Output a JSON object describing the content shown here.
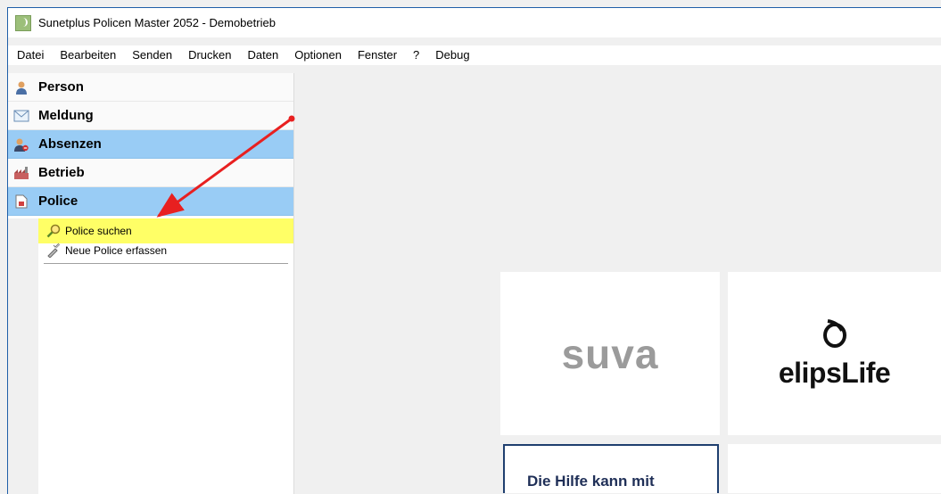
{
  "window": {
    "title": "Sunetplus Policen Master 2052 - Demobetrieb"
  },
  "menu": [
    "Datei",
    "Bearbeiten",
    "Senden",
    "Drucken",
    "Daten",
    "Optionen",
    "Fenster",
    "?",
    "Debug"
  ],
  "nav": {
    "sections": [
      {
        "label": "Person",
        "icon": "person-icon",
        "active": false
      },
      {
        "label": "Meldung",
        "icon": "envelope-icon",
        "active": false
      },
      {
        "label": "Absenzen",
        "icon": "absence-person-icon",
        "active": true
      },
      {
        "label": "Betrieb",
        "icon": "factory-icon",
        "active": false
      },
      {
        "label": "Police",
        "icon": "document-icon",
        "active": true
      }
    ],
    "police_items": [
      {
        "label": "Police suchen",
        "icon": "search-icon",
        "highlighted": true
      },
      {
        "label": "Neue Police erfassen",
        "icon": "new-policy-icon",
        "highlighted": false
      }
    ]
  },
  "tiles": {
    "suva": "suva",
    "elips": "elipsLife",
    "help": "Die Hilfe kann mit"
  },
  "colors": {
    "accent": "#99ccf5",
    "highlight": "#ffff66",
    "arrow": "#e82020"
  }
}
